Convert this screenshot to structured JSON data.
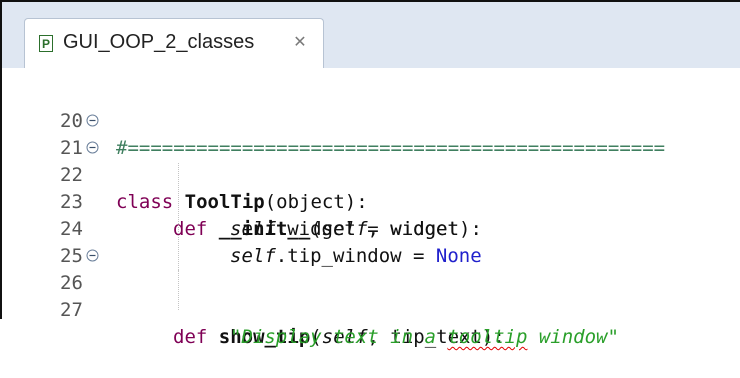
{
  "tab": {
    "title": "GUI_OOP_2_classes",
    "icon": "python-file-icon",
    "close": "✕"
  },
  "lines": [
    {
      "num": "20",
      "text": "#==============================================="
    },
    {
      "num": "21",
      "kw": "class",
      "name": "ToolTip",
      "rest": "(object):"
    },
    {
      "num": "22",
      "kw": "def",
      "name": "__init__",
      "open": "(",
      "self": "self",
      "rest": ", widget):"
    },
    {
      "num": "23",
      "self": "self",
      "rest": ".widget = widget"
    },
    {
      "num": "24",
      "self": "self",
      "rest": ".tip_window = ",
      "const": "None"
    },
    {
      "num": "25"
    },
    {
      "num": "26",
      "kw": "def",
      "name": "show_tip",
      "open": "(",
      "self": "self",
      "rest": ", tip_text):"
    },
    {
      "num": "27",
      "str_a": "\"Display text in a ",
      "str_err": "tooltip",
      "str_b": " window\""
    }
  ],
  "colors": {
    "keyword": "#7f0055",
    "comment": "#3f7f5f",
    "string": "#2a9f2a",
    "constant": "#2020cc",
    "tab_bar": "#dfe7f2"
  }
}
